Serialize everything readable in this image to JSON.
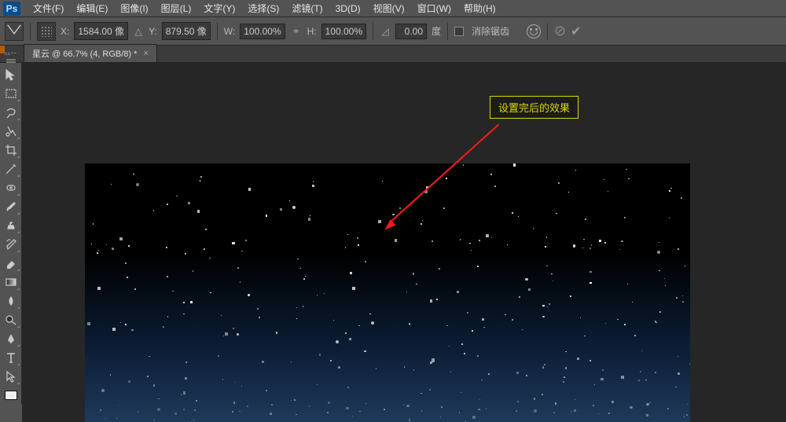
{
  "app": {
    "logo": "Ps"
  },
  "menu": {
    "items": [
      "文件(F)",
      "编辑(E)",
      "图像(I)",
      "图层(L)",
      "文字(Y)",
      "选择(S)",
      "滤镜(T)",
      "3D(D)",
      "视图(V)",
      "窗口(W)",
      "帮助(H)"
    ]
  },
  "options": {
    "x_label": "X:",
    "x_value": "1584.00 像",
    "y_label": "Y:",
    "y_value": "879.50 像",
    "w_label": "W:",
    "w_value": "100.00%",
    "h_label": "H:",
    "h_value": "100.00%",
    "angle_value": "0.00",
    "angle_unit": "度",
    "antialias": "消除锯齿"
  },
  "tab": {
    "title": "星云 @ 66.7% (4, RGB/8) *",
    "close": "×"
  },
  "annotation": {
    "text": "设置完后的效果"
  },
  "tools": [
    "move",
    "marquee",
    "lasso",
    "quick-select",
    "crop",
    "eyedropper",
    "healing",
    "brush",
    "clone",
    "history-brush",
    "eraser",
    "gradient",
    "blur",
    "dodge",
    "pen",
    "type",
    "path-select",
    "rectangle"
  ],
  "colors": {
    "accent_yellow": "#d8d800",
    "arrow_red": "#ff1a1a"
  }
}
